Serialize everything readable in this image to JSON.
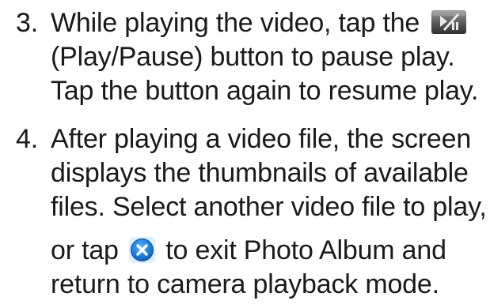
{
  "steps": [
    {
      "number": "3.",
      "line1_before_icon": "While playing the video, tap the ",
      "icon": "play-pause-icon",
      "line2": "(Play/Pause) button to pause play.",
      "line3": "Tap the button again to resume play."
    },
    {
      "number": "4.",
      "line1": "After playing a video file, the screen",
      "line2": "displays the thumbnails of available",
      "line3": "files. Select another video file to play,",
      "line4_before_icon": "or tap ",
      "icon": "close-circle-icon",
      "line4_after_icon": " to exit Photo Album and",
      "line5": "return to camera playback mode."
    }
  ],
  "colors": {
    "text": "#1a1a1a",
    "playpause_bg_top": "#8a8a8a",
    "playpause_bg_bottom": "#3e3e3e",
    "close_bg": "#1a7fe0",
    "close_glyph": "#ffffff"
  }
}
